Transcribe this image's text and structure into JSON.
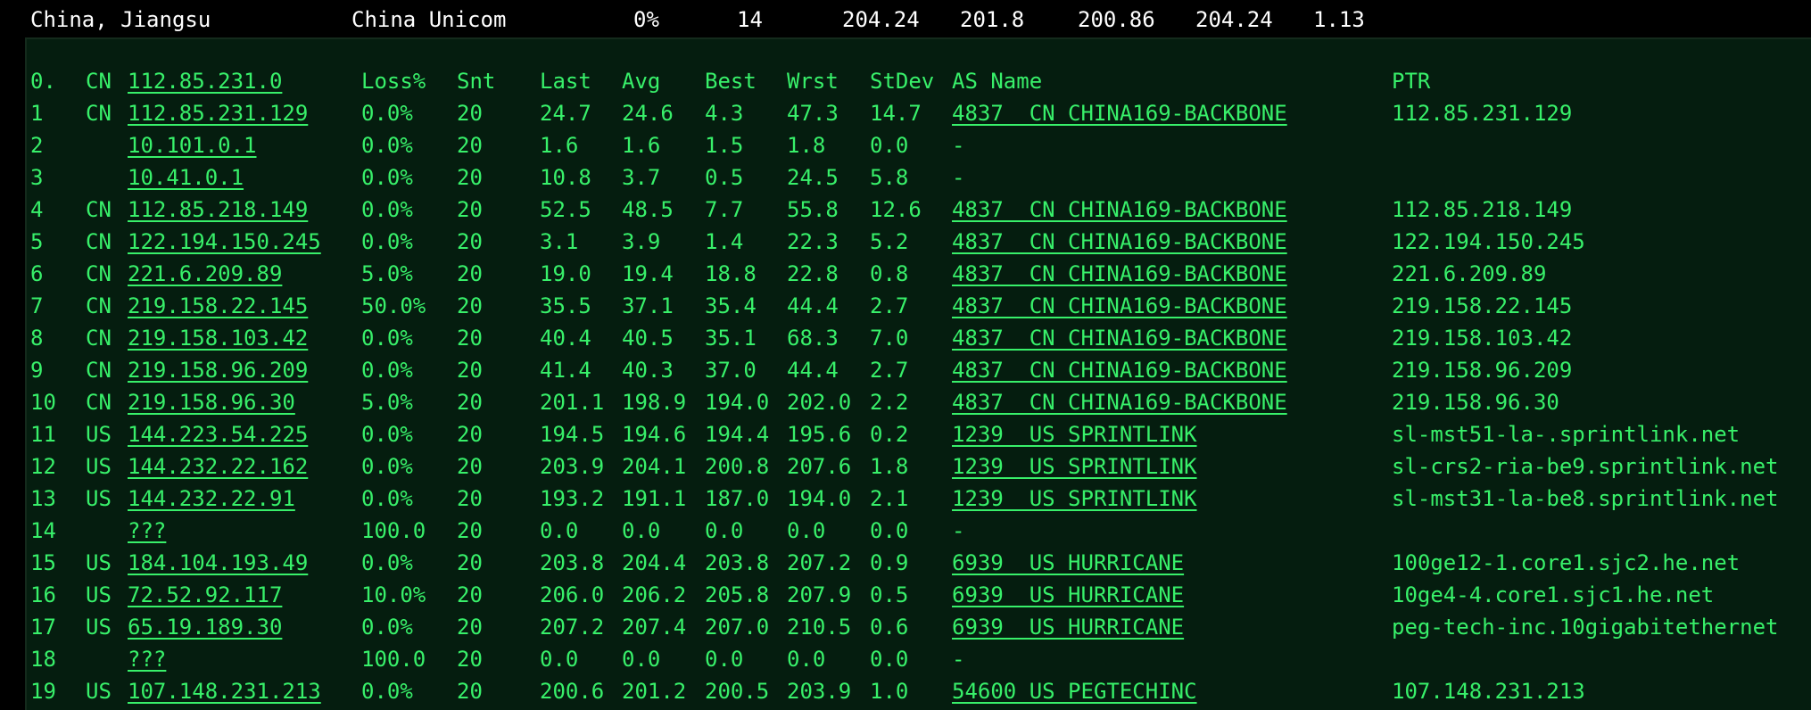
{
  "summary": {
    "location": "China, Jiangsu",
    "isp": "China Unicom",
    "loss": "0%",
    "count": "14",
    "last": "204.24",
    "avg": "201.8",
    "best": "200.86",
    "worst": "204.24",
    "stdev": "1.13"
  },
  "colors": {
    "background": "#000000",
    "panel_background": "#051d0f",
    "text_green": "#38f06a",
    "summary_text": "#ffffff"
  },
  "table": {
    "header": {
      "hop": "0.",
      "cc": "CN",
      "ip": "112.85.231.0",
      "loss": "Loss%",
      "snt": "Snt",
      "last": "Last",
      "avg": "Avg",
      "best": "Best",
      "wrst": "Wrst",
      "stdev": "StDev",
      "as_name": "AS Name",
      "ptr": "PTR"
    },
    "rows": [
      {
        "hop": "1",
        "cc": "CN",
        "ip": "112.85.231.129",
        "loss": "0.0%",
        "snt": "20",
        "last": "24.7",
        "avg": "24.6",
        "best": "4.3",
        "wrst": "47.3",
        "stdev": "14.7",
        "as_name": "4837  CN CHINA169-BACKBONE",
        "ptr": "112.85.231.129"
      },
      {
        "hop": "2",
        "cc": "",
        "ip": "10.101.0.1",
        "loss": "0.0%",
        "snt": "20",
        "last": "1.6",
        "avg": "1.6",
        "best": "1.5",
        "wrst": "1.8",
        "stdev": "0.0",
        "as_name": "-",
        "ptr": ""
      },
      {
        "hop": "3",
        "cc": "",
        "ip": "10.41.0.1",
        "loss": "0.0%",
        "snt": "20",
        "last": "10.8",
        "avg": "3.7",
        "best": "0.5",
        "wrst": "24.5",
        "stdev": "5.8",
        "as_name": "-",
        "ptr": ""
      },
      {
        "hop": "4",
        "cc": "CN",
        "ip": "112.85.218.149",
        "loss": "0.0%",
        "snt": "20",
        "last": "52.5",
        "avg": "48.5",
        "best": "7.7",
        "wrst": "55.8",
        "stdev": "12.6",
        "as_name": "4837  CN CHINA169-BACKBONE",
        "ptr": "112.85.218.149"
      },
      {
        "hop": "5",
        "cc": "CN",
        "ip": "122.194.150.245",
        "loss": "0.0%",
        "snt": "20",
        "last": "3.1",
        "avg": "3.9",
        "best": "1.4",
        "wrst": "22.3",
        "stdev": "5.2",
        "as_name": "4837  CN CHINA169-BACKBONE",
        "ptr": "122.194.150.245"
      },
      {
        "hop": "6",
        "cc": "CN",
        "ip": "221.6.209.89",
        "loss": "5.0%",
        "snt": "20",
        "last": "19.0",
        "avg": "19.4",
        "best": "18.8",
        "wrst": "22.8",
        "stdev": "0.8",
        "as_name": "4837  CN CHINA169-BACKBONE",
        "ptr": "221.6.209.89"
      },
      {
        "hop": "7",
        "cc": "CN",
        "ip": "219.158.22.145",
        "loss": "50.0%",
        "snt": "20",
        "last": "35.5",
        "avg": "37.1",
        "best": "35.4",
        "wrst": "44.4",
        "stdev": "2.7",
        "as_name": "4837  CN CHINA169-BACKBONE",
        "ptr": "219.158.22.145"
      },
      {
        "hop": "8",
        "cc": "CN",
        "ip": "219.158.103.42",
        "loss": "0.0%",
        "snt": "20",
        "last": "40.4",
        "avg": "40.5",
        "best": "35.1",
        "wrst": "68.3",
        "stdev": "7.0",
        "as_name": "4837  CN CHINA169-BACKBONE",
        "ptr": "219.158.103.42"
      },
      {
        "hop": "9",
        "cc": "CN",
        "ip": "219.158.96.209",
        "loss": "0.0%",
        "snt": "20",
        "last": "41.4",
        "avg": "40.3",
        "best": "37.0",
        "wrst": "44.4",
        "stdev": "2.7",
        "as_name": "4837  CN CHINA169-BACKBONE",
        "ptr": "219.158.96.209"
      },
      {
        "hop": "10",
        "cc": "CN",
        "ip": "219.158.96.30",
        "loss": "5.0%",
        "snt": "20",
        "last": "201.1",
        "avg": "198.9",
        "best": "194.0",
        "wrst": "202.0",
        "stdev": "2.2",
        "as_name": "4837  CN CHINA169-BACKBONE",
        "ptr": "219.158.96.30"
      },
      {
        "hop": "11",
        "cc": "US",
        "ip": "144.223.54.225",
        "loss": "0.0%",
        "snt": "20",
        "last": "194.5",
        "avg": "194.6",
        "best": "194.4",
        "wrst": "195.6",
        "stdev": "0.2",
        "as_name": "1239  US SPRINTLINK",
        "ptr": "sl-mst51-la-.sprintlink.net"
      },
      {
        "hop": "12",
        "cc": "US",
        "ip": "144.232.22.162",
        "loss": "0.0%",
        "snt": "20",
        "last": "203.9",
        "avg": "204.1",
        "best": "200.8",
        "wrst": "207.6",
        "stdev": "1.8",
        "as_name": "1239  US SPRINTLINK",
        "ptr": "sl-crs2-ria-be9.sprintlink.net"
      },
      {
        "hop": "13",
        "cc": "US",
        "ip": "144.232.22.91",
        "loss": "0.0%",
        "snt": "20",
        "last": "193.2",
        "avg": "191.1",
        "best": "187.0",
        "wrst": "194.0",
        "stdev": "2.1",
        "as_name": "1239  US SPRINTLINK",
        "ptr": "sl-mst31-la-be8.sprintlink.net"
      },
      {
        "hop": "14",
        "cc": "",
        "ip": "???",
        "loss": "100.0",
        "snt": "20",
        "last": "0.0",
        "avg": "0.0",
        "best": "0.0",
        "wrst": "0.0",
        "stdev": "0.0",
        "as_name": "-",
        "ptr": ""
      },
      {
        "hop": "15",
        "cc": "US",
        "ip": "184.104.193.49",
        "loss": "0.0%",
        "snt": "20",
        "last": "203.8",
        "avg": "204.4",
        "best": "203.8",
        "wrst": "207.2",
        "stdev": "0.9",
        "as_name": "6939  US HURRICANE",
        "ptr": "100ge12-1.core1.sjc2.he.net"
      },
      {
        "hop": "16",
        "cc": "US",
        "ip": "72.52.92.117",
        "loss": "10.0%",
        "snt": "20",
        "last": "206.0",
        "avg": "206.2",
        "best": "205.8",
        "wrst": "207.9",
        "stdev": "0.5",
        "as_name": "6939  US HURRICANE",
        "ptr": "10ge4-4.core1.sjc1.he.net"
      },
      {
        "hop": "17",
        "cc": "US",
        "ip": "65.19.189.30",
        "loss": "0.0%",
        "snt": "20",
        "last": "207.2",
        "avg": "207.4",
        "best": "207.0",
        "wrst": "210.5",
        "stdev": "0.6",
        "as_name": "6939  US HURRICANE",
        "ptr": "peg-tech-inc.10gigabitethernet"
      },
      {
        "hop": "18",
        "cc": "",
        "ip": "???",
        "loss": "100.0",
        "snt": "20",
        "last": "0.0",
        "avg": "0.0",
        "best": "0.0",
        "wrst": "0.0",
        "stdev": "0.0",
        "as_name": "-",
        "ptr": ""
      },
      {
        "hop": "19",
        "cc": "US",
        "ip": "107.148.231.213",
        "loss": "0.0%",
        "snt": "20",
        "last": "200.6",
        "avg": "201.2",
        "best": "200.5",
        "wrst": "203.9",
        "stdev": "1.0",
        "as_name": "54600 US PEGTECHINC",
        "ptr": "107.148.231.213"
      }
    ]
  }
}
